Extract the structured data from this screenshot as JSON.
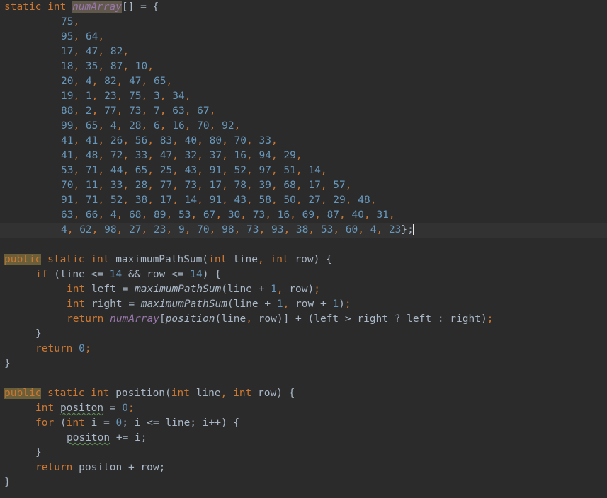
{
  "editor": {
    "language": "Java",
    "theme": "Darcula",
    "colors": {
      "background": "#2b2b2b",
      "current_line": "#323232",
      "keyword": "#cc7832",
      "number": "#6897bb",
      "identifier": "#a9b7c6",
      "field": "#9876aa",
      "usage_highlight": "#60594b",
      "keyword_highlight": "#6b5f3a",
      "typo_squiggle": "#629755",
      "indent_guide": "#3b3f41",
      "caret": "#e8e8e8"
    },
    "caret_line": 18,
    "caret_column": 64
  },
  "code": {
    "declaration": {
      "kw_static": "static",
      "kw_int": "int",
      "field_name": "numArray",
      "brackets": "[] = {",
      "terminator": "};"
    },
    "array_rows": [
      "75,",
      "95, 64,",
      "17, 47, 82,",
      "18, 35, 87, 10,",
      "20, 4, 82, 47, 65,",
      "19, 1, 23, 75, 3, 34,",
      "88, 2, 77, 73, 7, 63, 67,",
      "99, 65, 4, 28, 6, 16, 70, 92,",
      "41, 41, 26, 56, 83, 40, 80, 70, 33,",
      "41, 48, 72, 33, 47, 32, 37, 16, 94, 29,",
      "53, 71, 44, 65, 25, 43, 91, 52, 97, 51, 14,",
      "70, 11, 33, 28, 77, 73, 17, 78, 39, 68, 17, 57,",
      "91, 71, 52, 38, 17, 14, 91, 43, 58, 50, 27, 29, 48,",
      "63, 66, 4, 68, 89, 53, 67, 30, 73, 16, 69, 87, 40, 31,",
      "4, 62, 98, 27, 23, 9, 70, 98, 73, 93, 38, 53, 60, 4, 23"
    ],
    "method_max": {
      "mod_public": "public",
      "mod_static": "static",
      "ret_int": "int",
      "name": "maximumPathSum",
      "params": "(int line, int row) {",
      "param_type": "int",
      "param_one": "line",
      "param_two": "row",
      "if_kw": "if",
      "if_cond": "(line <= 14 && row <= 14) {",
      "if_num_a": "14",
      "if_num_b": "14",
      "decl_left_type": "int",
      "decl_left_name": "left",
      "call_left": "maximumPathSum",
      "call_left_args": "(line + 1, row);",
      "decl_right_type": "int",
      "decl_right_name": "right",
      "call_right": "maximumPathSum",
      "call_right_args": "(line + 1, row + 1);",
      "return_kw": "return",
      "return_field": "numArray",
      "return_index": "position",
      "return_tail": "(line, row)] + (left > right ? left : right);",
      "close_if": "}",
      "return_zero_kw": "return",
      "return_zero_val": "0",
      "return_zero_semi": ";",
      "close_method": "}"
    },
    "method_pos": {
      "mod_public": "public",
      "mod_static": "static",
      "ret_int": "int",
      "name": "position",
      "params": "(int line, int row) {",
      "var_type": "int",
      "var_name": "positon",
      "var_assign": " = ",
      "var_value": "0",
      "var_semi": ";",
      "for_kw": "for",
      "for_open": "(",
      "for_type": "int",
      "for_init": " i = ",
      "for_zero": "0",
      "for_semi1": "; i <= line; i++) {",
      "body_var": "positon",
      "body_op": " += i;",
      "close_for": "}",
      "return_kw": "return",
      "return_expr": "positon + row;",
      "close_method": "}"
    }
  }
}
